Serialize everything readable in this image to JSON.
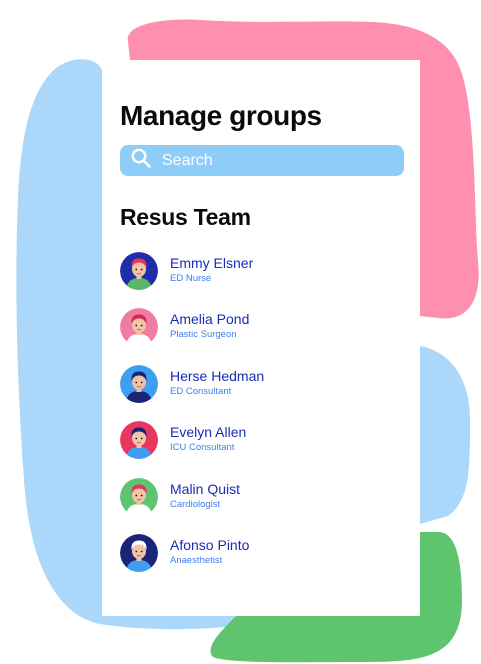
{
  "colors": {
    "pink_blob": "#ff8fae",
    "blue_blob": "#abd7fa",
    "green_blob": "#5fc46e",
    "search_bg": "#8ecdf7",
    "name_color": "#1a2bb8",
    "role_color": "#3f7ef0"
  },
  "page": {
    "title": "Manage groups"
  },
  "search": {
    "placeholder": "Search",
    "icon": "search-icon"
  },
  "group": {
    "name": "Resus Team",
    "members": [
      {
        "name": "Emmy Elsner",
        "role": "ED Nurse",
        "avatar_bg": "#1e2ea8",
        "skin": "#f2c3a4",
        "hair": "#e4365b",
        "shirt": "#57b86a"
      },
      {
        "name": "Amelia Pond",
        "role": "Plastic Surgeon",
        "avatar_bg": "#f07ba3",
        "skin": "#f1c6a8",
        "hair": "#c93050",
        "shirt": "#ffffff"
      },
      {
        "name": "Herse Hedman",
        "role": "ED Consultant",
        "avatar_bg": "#3d9ef2",
        "skin": "#efc19f",
        "hair": "#1b2577",
        "shirt": "#1b2577"
      },
      {
        "name": "Evelyn Allen",
        "role": "ICU Consultant",
        "avatar_bg": "#e8365f",
        "skin": "#f3c6a8",
        "hair": "#1b2577",
        "shirt": "#3d9ef2"
      },
      {
        "name": "Malin Quist",
        "role": "Cardiologist",
        "avatar_bg": "#5fc46e",
        "skin": "#f2c3a4",
        "hair": "#e4365b",
        "shirt": "#ffffff"
      },
      {
        "name": "Afonso Pinto",
        "role": "Anaesthetist",
        "avatar_bg": "#1b2577",
        "skin": "#f1c6a8",
        "hair": "#ffffff",
        "shirt": "#3d9ef2"
      }
    ]
  }
}
